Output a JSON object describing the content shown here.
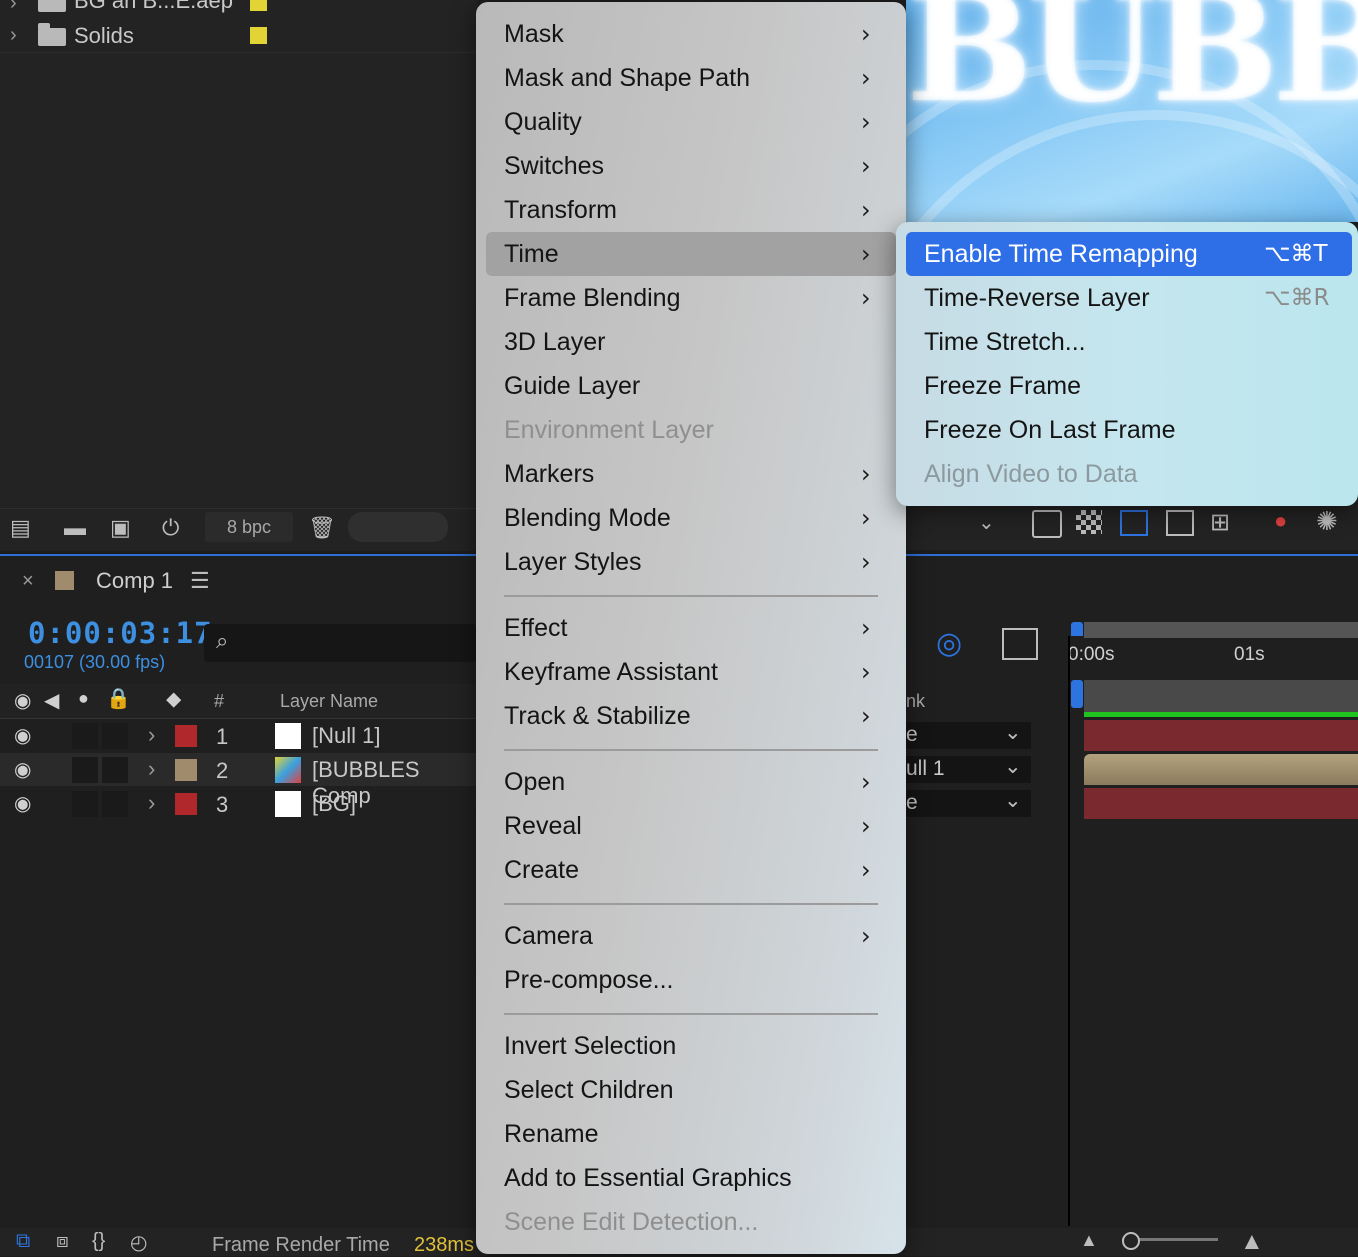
{
  "project": {
    "items": [
      {
        "name": "BG an B...E.aep",
        "color": "#e2d435"
      },
      {
        "name": "Solids",
        "color": "#e2d435"
      }
    ],
    "bpc": "8 bpc"
  },
  "timeline": {
    "tab_title": "Comp 1",
    "tab_color": "#a08c6c",
    "timecode": "0:00:03:17",
    "frames": "00107 (30.00 fps)",
    "header": {
      "number": "#",
      "layer_name": "Layer Name",
      "parent": "nk"
    },
    "layers": [
      {
        "num": "1",
        "name": "[Null 1]",
        "color": "#b0272c",
        "parent": "e"
      },
      {
        "num": "2",
        "name": "[BUBBLES Comp",
        "color": "#a08c6c",
        "parent": "ull 1"
      },
      {
        "num": "3",
        "name": "[BG]",
        "color": "#b0272c",
        "parent": "e"
      }
    ],
    "ruler": [
      "0:00s",
      "01s"
    ],
    "render_label": "Frame Render Time",
    "render_value": "238ms"
  },
  "viewer": {
    "art_text": "BUBBL"
  },
  "context_menu": {
    "items": [
      {
        "label": "Mask",
        "submenu": true
      },
      {
        "label": "Mask and Shape Path",
        "submenu": true
      },
      {
        "label": "Quality",
        "submenu": true
      },
      {
        "label": "Switches",
        "submenu": true
      },
      {
        "label": "Transform",
        "submenu": true
      },
      {
        "label": "Time",
        "submenu": true,
        "highlighted": true
      },
      {
        "label": "Frame Blending",
        "submenu": true
      },
      {
        "label": "3D Layer"
      },
      {
        "label": "Guide Layer"
      },
      {
        "label": "Environment Layer",
        "disabled": true
      },
      {
        "label": "Markers",
        "submenu": true
      },
      {
        "label": "Blending Mode",
        "submenu": true
      },
      {
        "label": "Layer Styles",
        "submenu": true
      },
      {
        "label": "Effect",
        "submenu": true
      },
      {
        "label": "Keyframe Assistant",
        "submenu": true
      },
      {
        "label": "Track & Stabilize",
        "submenu": true
      },
      {
        "label": "Open",
        "submenu": true
      },
      {
        "label": "Reveal",
        "submenu": true
      },
      {
        "label": "Create",
        "submenu": true
      },
      {
        "label": "Camera",
        "submenu": true
      },
      {
        "label": "Pre-compose..."
      },
      {
        "label": "Invert Selection"
      },
      {
        "label": "Select Children"
      },
      {
        "label": "Rename"
      },
      {
        "label": "Add to Essential Graphics"
      },
      {
        "label": "Scene Edit Detection...",
        "disabled": true
      }
    ]
  },
  "time_submenu": {
    "items": [
      {
        "label": "Enable Time Remapping",
        "shortcut": "⌥⌘T",
        "selected": true
      },
      {
        "label": "Time-Reverse Layer",
        "shortcut": "⌥⌘R"
      },
      {
        "label": "Time Stretch..."
      },
      {
        "label": "Freeze Frame"
      },
      {
        "label": "Freeze On Last Frame"
      },
      {
        "label": "Align Video to Data",
        "disabled": true
      }
    ]
  },
  "colors": {
    "accent": "#2e6ee6",
    "timecode": "#3d8fe0",
    "render_time": "#e0c23a",
    "work_area_bar": "#21c321",
    "clip_red": "#7a2a2e"
  }
}
